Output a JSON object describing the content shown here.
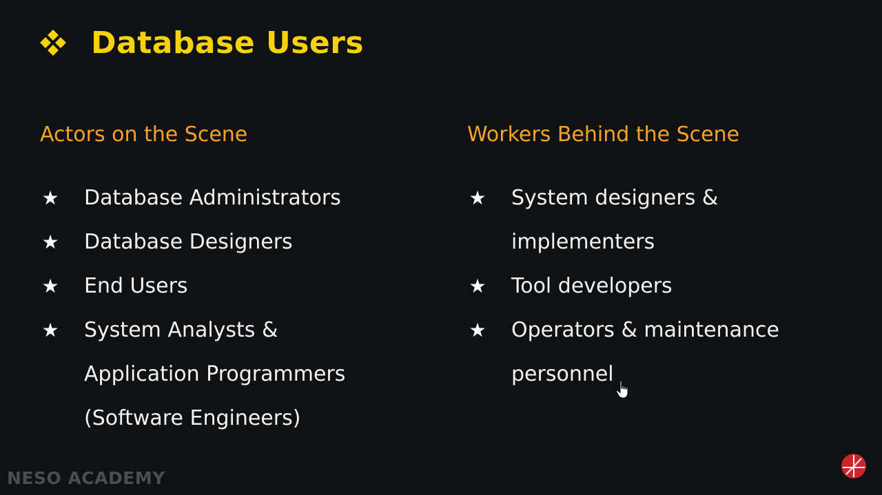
{
  "slide": {
    "title": "Database Users",
    "left_column": {
      "heading": "Actors on the Scene",
      "items": [
        {
          "text": "Database Administrators"
        },
        {
          "text": "Database Designers"
        },
        {
          "text": "End Users"
        },
        {
          "text": "System Analysts &\nApplication Programmers\n(Software Engineers)"
        }
      ]
    },
    "right_column": {
      "heading": "Workers Behind the Scene",
      "items": [
        {
          "text": "System designers &\nimplementers"
        },
        {
          "text": "Tool developers"
        },
        {
          "text": "Operators & maintenance\npersonnel"
        }
      ]
    },
    "bullet_glyph": "★"
  },
  "branding": {
    "watermark": "NESO ACADEMY",
    "logo_icon": "neso-logo-icon"
  },
  "colors": {
    "background": "#0f1113",
    "title": "#f5d20a",
    "heading": "#f7a22a",
    "text": "#f2f2f2",
    "logo": "#c8262b"
  }
}
